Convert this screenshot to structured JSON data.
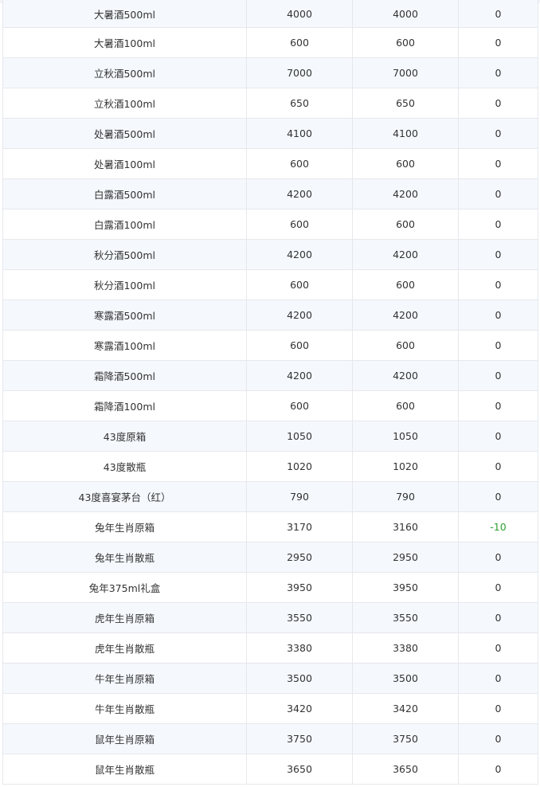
{
  "table": {
    "rows": [
      {
        "name": "大暑酒500ml",
        "col2": "4000",
        "col3": "4000",
        "change": "0"
      },
      {
        "name": "大暑酒100ml",
        "col2": "600",
        "col3": "600",
        "change": "0"
      },
      {
        "name": "立秋酒500ml",
        "col2": "7000",
        "col3": "7000",
        "change": "0"
      },
      {
        "name": "立秋酒100ml",
        "col2": "650",
        "col3": "650",
        "change": "0"
      },
      {
        "name": "处暑酒500ml",
        "col2": "4100",
        "col3": "4100",
        "change": "0"
      },
      {
        "name": "处暑酒100ml",
        "col2": "600",
        "col3": "600",
        "change": "0"
      },
      {
        "name": "白露酒500ml",
        "col2": "4200",
        "col3": "4200",
        "change": "0"
      },
      {
        "name": "白露酒100ml",
        "col2": "600",
        "col3": "600",
        "change": "0"
      },
      {
        "name": "秋分酒500ml",
        "col2": "4200",
        "col3": "4200",
        "change": "0"
      },
      {
        "name": "秋分酒100ml",
        "col2": "600",
        "col3": "600",
        "change": "0"
      },
      {
        "name": "寒露酒500ml",
        "col2": "4200",
        "col3": "4200",
        "change": "0"
      },
      {
        "name": "寒露酒100ml",
        "col2": "600",
        "col3": "600",
        "change": "0"
      },
      {
        "name": "霜降酒500ml",
        "col2": "4200",
        "col3": "4200",
        "change": "0"
      },
      {
        "name": "霜降酒100ml",
        "col2": "600",
        "col3": "600",
        "change": "0"
      },
      {
        "name": "43度原箱",
        "col2": "1050",
        "col3": "1050",
        "change": "0"
      },
      {
        "name": "43度散瓶",
        "col2": "1020",
        "col3": "1020",
        "change": "0"
      },
      {
        "name": "43度喜宴茅台（红）",
        "col2": "790",
        "col3": "790",
        "change": "0"
      },
      {
        "name": "兔年生肖原箱",
        "col2": "3170",
        "col3": "3160",
        "change": "-10"
      },
      {
        "name": "兔年生肖散瓶",
        "col2": "2950",
        "col3": "2950",
        "change": "0"
      },
      {
        "name": "兔年375ml礼盒",
        "col2": "3950",
        "col3": "3950",
        "change": "0"
      },
      {
        "name": "虎年生肖原箱",
        "col2": "3550",
        "col3": "3550",
        "change": "0"
      },
      {
        "name": "虎年生肖散瓶",
        "col2": "3380",
        "col3": "3380",
        "change": "0"
      },
      {
        "name": "牛年生肖原箱",
        "col2": "3500",
        "col3": "3500",
        "change": "0"
      },
      {
        "name": "牛年生肖散瓶",
        "col2": "3420",
        "col3": "3420",
        "change": "0"
      },
      {
        "name": "鼠年生肖原箱",
        "col2": "3750",
        "col3": "3750",
        "change": "0"
      },
      {
        "name": "鼠年生肖散瓶",
        "col2": "3650",
        "col3": "3650",
        "change": "0"
      }
    ]
  },
  "colors": {
    "negative_change": "#2ea02e",
    "row_stripe": "#f5f8fd",
    "border": "#e6e8ec"
  }
}
